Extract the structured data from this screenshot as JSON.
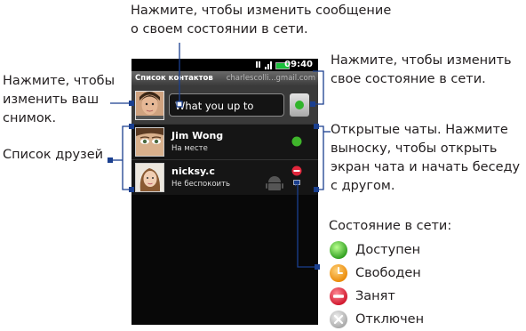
{
  "callouts": {
    "top": [
      "Нажмите, чтобы изменить сообщение",
      "о своем состоянии в сети."
    ],
    "left_photo": [
      "Нажмите, чтобы",
      "изменить ваш",
      "снимок."
    ],
    "left_friends": [
      "Список друзей"
    ],
    "right_status": [
      "Нажмите, чтобы изменить",
      "свое состояние в сети."
    ],
    "right_chats": [
      "Открытые чаты. Нажмите",
      "выноску, чтобы открыть",
      "экран чата и начать беседу",
      "с другом."
    ]
  },
  "legend": {
    "title": "Состояние в сети:",
    "items": [
      {
        "label": "Доступен",
        "icon": "available-icon",
        "color": "#3fb52b"
      },
      {
        "label": "Свободен",
        "icon": "idle-icon",
        "color": "#f39a1a"
      },
      {
        "label": "Занят",
        "icon": "busy-icon",
        "color": "#e0263b"
      },
      {
        "label": "Отключен",
        "icon": "offline-icon",
        "color": "#bdbdbd"
      }
    ]
  },
  "phone": {
    "time": "09:40",
    "title": "Список контактов",
    "account": "charlescolli...gmail.com",
    "status_placeholder": "What you up to",
    "contacts": [
      {
        "name": "Jim Wong",
        "status": "На месте",
        "presence": "available"
      },
      {
        "name": "nicksy.c",
        "status": "Не беспокоить",
        "presence": "busy"
      }
    ]
  },
  "colors": {
    "accent_line": "#1a3f8f",
    "available": "#3fb52b",
    "busy": "#e0263b"
  }
}
